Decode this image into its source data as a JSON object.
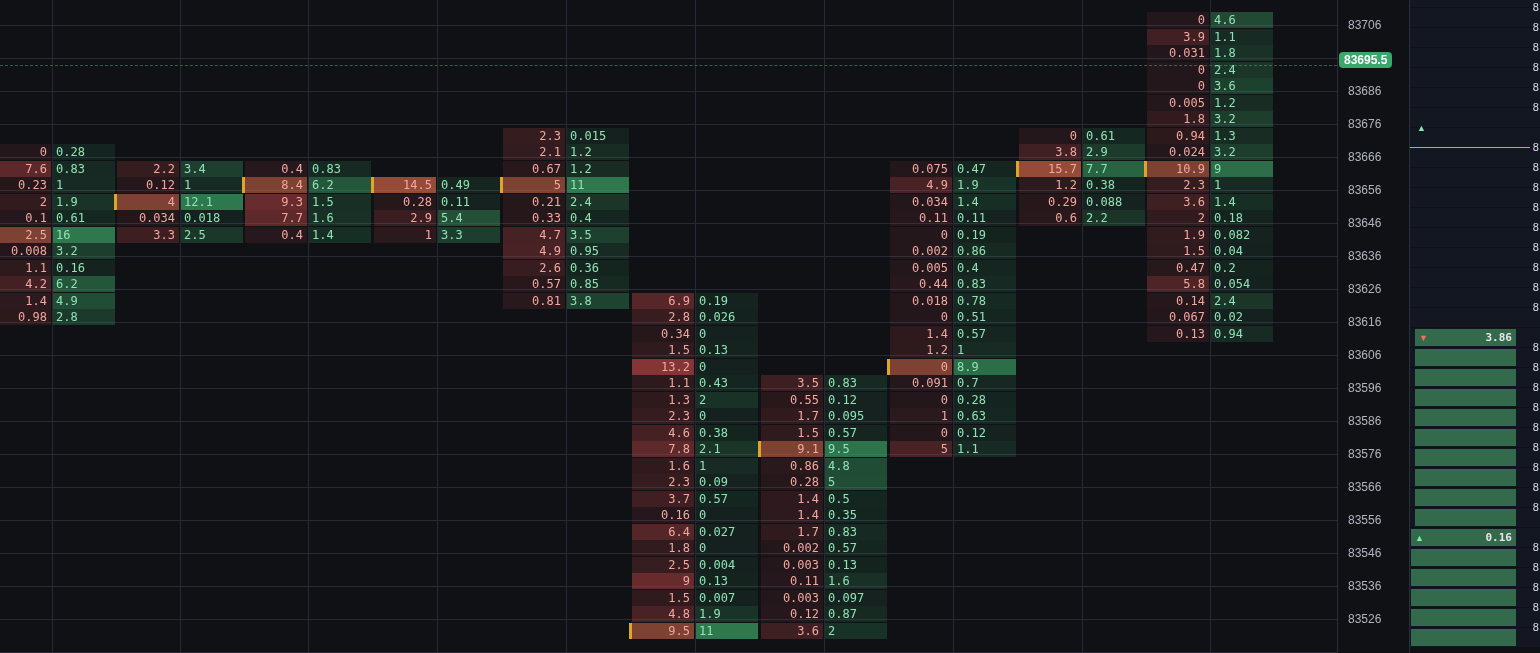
{
  "clusters": [
    {
      "rows": [
        {
          "bid": "0",
          "ask": "0.28",
          "poc": false
        },
        {
          "bid": "7.6",
          "ask": "0.83",
          "poc": false
        },
        {
          "bid": "0.23",
          "ask": "1",
          "poc": false
        },
        {
          "bid": "2",
          "ask": "1.9",
          "poc": false
        },
        {
          "bid": "0.1",
          "ask": "0.61",
          "poc": false
        },
        {
          "bid": "2.5",
          "ask": "16",
          "poc": true
        },
        {
          "bid": "0.008",
          "ask": "3.2",
          "poc": false
        },
        {
          "bid": "1.1",
          "ask": "0.16",
          "poc": false
        },
        {
          "bid": "4.2",
          "ask": "6.2",
          "poc": false
        },
        {
          "bid": "1.4",
          "ask": "4.9",
          "poc": false
        },
        {
          "bid": "0.98",
          "ask": "2.8",
          "poc": false
        }
      ]
    },
    {
      "rows": [
        {
          "bid": "2.2",
          "ask": "3.4",
          "poc": false
        },
        {
          "bid": "0.12",
          "ask": "1",
          "poc": false
        },
        {
          "bid": "4",
          "ask": "12.1",
          "poc": true
        },
        {
          "bid": "0.034",
          "ask": "0.018",
          "poc": false
        },
        {
          "bid": "3.3",
          "ask": "2.5",
          "poc": false
        }
      ]
    },
    {
      "rows": [
        {
          "bid": "0.4",
          "ask": "0.83",
          "poc": false
        },
        {
          "bid": "8.4",
          "ask": "6.2",
          "poc": true
        },
        {
          "bid": "9.3",
          "ask": "1.5",
          "poc": false
        },
        {
          "bid": "7.7",
          "ask": "1.6",
          "poc": false
        },
        {
          "bid": "0.4",
          "ask": "1.4",
          "poc": false
        }
      ]
    },
    {
      "rows": [
        {
          "bid": "14.5",
          "ask": "0.49",
          "poc": true
        },
        {
          "bid": "0.28",
          "ask": "0.11",
          "poc": false
        },
        {
          "bid": "2.9",
          "ask": "5.4",
          "poc": false
        },
        {
          "bid": "1",
          "ask": "3.3",
          "poc": false
        }
      ]
    },
    {
      "rows": [
        {
          "bid": "2.3",
          "ask": "0.015",
          "poc": false
        },
        {
          "bid": "2.1",
          "ask": "1.2",
          "poc": false
        },
        {
          "bid": "0.67",
          "ask": "1.2",
          "poc": false
        },
        {
          "bid": "5",
          "ask": "11",
          "poc": true
        },
        {
          "bid": "0.21",
          "ask": "2.4",
          "poc": false
        },
        {
          "bid": "0.33",
          "ask": "0.4",
          "poc": false
        },
        {
          "bid": "4.7",
          "ask": "3.5",
          "poc": false
        },
        {
          "bid": "4.9",
          "ask": "0.95",
          "poc": false
        },
        {
          "bid": "2.6",
          "ask": "0.36",
          "poc": false
        },
        {
          "bid": "0.57",
          "ask": "0.85",
          "poc": false
        },
        {
          "bid": "0.81",
          "ask": "3.8",
          "poc": false
        }
      ]
    },
    {
      "rows": [
        {
          "bid": "6.9",
          "ask": "0.19",
          "poc": false
        },
        {
          "bid": "2.8",
          "ask": "0.026",
          "poc": false
        },
        {
          "bid": "0.34",
          "ask": "0",
          "poc": false
        },
        {
          "bid": "1.5",
          "ask": "0.13",
          "poc": false
        },
        {
          "bid": "13.2",
          "ask": "0",
          "poc": false
        },
        {
          "bid": "1.1",
          "ask": "0.43",
          "poc": false
        },
        {
          "bid": "1.3",
          "ask": "2",
          "poc": false
        },
        {
          "bid": "2.3",
          "ask": "0",
          "poc": false
        },
        {
          "bid": "4.6",
          "ask": "0.38",
          "poc": false
        },
        {
          "bid": "7.8",
          "ask": "2.1",
          "poc": false
        },
        {
          "bid": "1.6",
          "ask": "1",
          "poc": false
        },
        {
          "bid": "2.3",
          "ask": "0.09",
          "poc": false
        },
        {
          "bid": "3.7",
          "ask": "0.57",
          "poc": false
        },
        {
          "bid": "0.16",
          "ask": "0",
          "poc": false
        },
        {
          "bid": "6.4",
          "ask": "0.027",
          "poc": false
        },
        {
          "bid": "1.8",
          "ask": "0",
          "poc": false
        },
        {
          "bid": "2.5",
          "ask": "0.004",
          "poc": false
        },
        {
          "bid": "9",
          "ask": "0.13",
          "poc": false
        },
        {
          "bid": "1.5",
          "ask": "0.007",
          "poc": false
        },
        {
          "bid": "4.8",
          "ask": "1.9",
          "poc": false
        },
        {
          "bid": "9.5",
          "ask": "11",
          "poc": true
        }
      ]
    },
    {
      "rows": [
        {
          "bid": "3.5",
          "ask": "0.83",
          "poc": false
        },
        {
          "bid": "0.55",
          "ask": "0.12",
          "poc": false
        },
        {
          "bid": "1.7",
          "ask": "0.095",
          "poc": false
        },
        {
          "bid": "1.5",
          "ask": "0.57",
          "poc": false
        },
        {
          "bid": "9.1",
          "ask": "9.5",
          "poc": true
        },
        {
          "bid": "0.86",
          "ask": "4.8",
          "poc": false
        },
        {
          "bid": "0.28",
          "ask": "5",
          "poc": false
        },
        {
          "bid": "1.4",
          "ask": "0.5",
          "poc": false
        },
        {
          "bid": "1.4",
          "ask": "0.35",
          "poc": false
        },
        {
          "bid": "1.7",
          "ask": "0.83",
          "poc": false
        },
        {
          "bid": "0.002",
          "ask": "0.57",
          "poc": false
        },
        {
          "bid": "0.003",
          "ask": "0.13",
          "poc": false
        },
        {
          "bid": "0.11",
          "ask": "1.6",
          "poc": false
        },
        {
          "bid": "0.003",
          "ask": "0.097",
          "poc": false
        },
        {
          "bid": "0.12",
          "ask": "0.87",
          "poc": false
        },
        {
          "bid": "3.6",
          "ask": "2",
          "poc": false
        }
      ]
    },
    {
      "rows": [
        {
          "bid": "0.075",
          "ask": "0.47",
          "poc": false
        },
        {
          "bid": "4.9",
          "ask": "1.9",
          "poc": false
        },
        {
          "bid": "0.034",
          "ask": "1.4",
          "poc": false
        },
        {
          "bid": "0.11",
          "ask": "0.11",
          "poc": false
        },
        {
          "bid": "0",
          "ask": "0.19",
          "poc": false
        },
        {
          "bid": "0.002",
          "ask": "0.86",
          "poc": false
        },
        {
          "bid": "0.005",
          "ask": "0.4",
          "poc": false
        },
        {
          "bid": "0.44",
          "ask": "0.83",
          "poc": false
        },
        {
          "bid": "0.018",
          "ask": "0.78",
          "poc": false
        },
        {
          "bid": "0",
          "ask": "0.51",
          "poc": false
        },
        {
          "bid": "1.4",
          "ask": "0.57",
          "poc": false
        },
        {
          "bid": "1.2",
          "ask": "1",
          "poc": false
        },
        {
          "bid": "0",
          "ask": "8.9",
          "poc": true
        },
        {
          "bid": "0.091",
          "ask": "0.7",
          "poc": false
        },
        {
          "bid": "0",
          "ask": "0.28",
          "poc": false
        },
        {
          "bid": "1",
          "ask": "0.63",
          "poc": false
        },
        {
          "bid": "0",
          "ask": "0.12",
          "poc": false
        },
        {
          "bid": "5",
          "ask": "1.1",
          "poc": false
        }
      ]
    },
    {
      "rows": [
        {
          "bid": "0",
          "ask": "0.61",
          "poc": false
        },
        {
          "bid": "3.8",
          "ask": "2.9",
          "poc": false
        },
        {
          "bid": "15.7",
          "ask": "7.7",
          "poc": true
        },
        {
          "bid": "1.2",
          "ask": "0.38",
          "poc": false
        },
        {
          "bid": "0.29",
          "ask": "0.088",
          "poc": false
        },
        {
          "bid": "0.6",
          "ask": "2.2",
          "poc": false
        }
      ]
    },
    {
      "rows": [
        {
          "bid": "0",
          "ask": "4.6",
          "poc": false
        },
        {
          "bid": "3.9",
          "ask": "1.1",
          "poc": false
        },
        {
          "bid": "0.031",
          "ask": "1.8",
          "poc": false
        },
        {
          "bid": "0",
          "ask": "2.4",
          "poc": false
        },
        {
          "bid": "0",
          "ask": "3.6",
          "poc": false
        },
        {
          "bid": "0.005",
          "ask": "1.2",
          "poc": false
        },
        {
          "bid": "1.8",
          "ask": "3.2",
          "poc": false
        },
        {
          "bid": "0.94",
          "ask": "1.3",
          "poc": false
        },
        {
          "bid": "0.024",
          "ask": "3.2",
          "poc": false
        },
        {
          "bid": "10.9",
          "ask": "9",
          "poc": true
        },
        {
          "bid": "2.3",
          "ask": "1",
          "poc": false
        },
        {
          "bid": "3.6",
          "ask": "1.4",
          "poc": false
        },
        {
          "bid": "2",
          "ask": "0.18",
          "poc": false
        },
        {
          "bid": "1.9",
          "ask": "0.082",
          "poc": false
        },
        {
          "bid": "1.5",
          "ask": "0.04",
          "poc": false
        },
        {
          "bid": "0.47",
          "ask": "0.2",
          "poc": false
        },
        {
          "bid": "5.8",
          "ask": "0.054",
          "poc": false
        },
        {
          "bid": "0.14",
          "ask": "2.4",
          "poc": false
        },
        {
          "bid": "0.067",
          "ask": "0.02",
          "poc": false
        },
        {
          "bid": "0.13",
          "ask": "0.94",
          "poc": false
        }
      ]
    }
  ],
  "price_axis": {
    "labels": [
      "83706",
      "83686",
      "83676",
      "83666",
      "83656",
      "83646",
      "83636",
      "83626",
      "83616",
      "83606",
      "83596",
      "83586",
      "83576",
      "83566",
      "83556",
      "83546",
      "83536",
      "83526"
    ],
    "current_price": "83695.5"
  },
  "dom": {
    "rows": [
      {
        "kind": "empty",
        "edge": "8"
      },
      {
        "kind": "empty",
        "edge": "8"
      },
      {
        "kind": "empty",
        "edge": "8"
      },
      {
        "kind": "empty",
        "edge": "8"
      },
      {
        "kind": "empty",
        "edge": "8"
      },
      {
        "kind": "empty",
        "edge": "8"
      },
      {
        "kind": "marker",
        "arrow": "▲"
      },
      {
        "kind": "empty",
        "edge": "8"
      },
      {
        "kind": "empty",
        "edge": "8"
      },
      {
        "kind": "empty",
        "edge": "8"
      },
      {
        "kind": "empty",
        "edge": "8"
      },
      {
        "kind": "empty",
        "edge": "8"
      },
      {
        "kind": "empty",
        "edge": "8"
      },
      {
        "kind": "empty",
        "edge": "8"
      },
      {
        "kind": "empty",
        "edge": "8"
      },
      {
        "kind": "empty",
        "edge": "8"
      },
      {
        "kind": "bar",
        "arrow": "▼",
        "value": "3.86"
      },
      {
        "kind": "bar",
        "edge": "8"
      },
      {
        "kind": "bar",
        "edge": "8"
      },
      {
        "kind": "bar",
        "edge": "8"
      },
      {
        "kind": "bar",
        "edge": "8"
      },
      {
        "kind": "bar",
        "edge": "8"
      },
      {
        "kind": "bar",
        "edge": "8"
      },
      {
        "kind": "bar",
        "edge": "8"
      },
      {
        "kind": "bar",
        "edge": "8"
      },
      {
        "kind": "bar",
        "edge": "8"
      },
      {
        "kind": "bar",
        "arrow": "▲",
        "value": "0.16"
      },
      {
        "kind": "bar",
        "edge": "8"
      },
      {
        "kind": "bar",
        "edge": "8"
      },
      {
        "kind": "bar",
        "edge": "8"
      },
      {
        "kind": "bar",
        "edge": "8"
      },
      {
        "kind": "bar",
        "edge": "8"
      }
    ]
  }
}
